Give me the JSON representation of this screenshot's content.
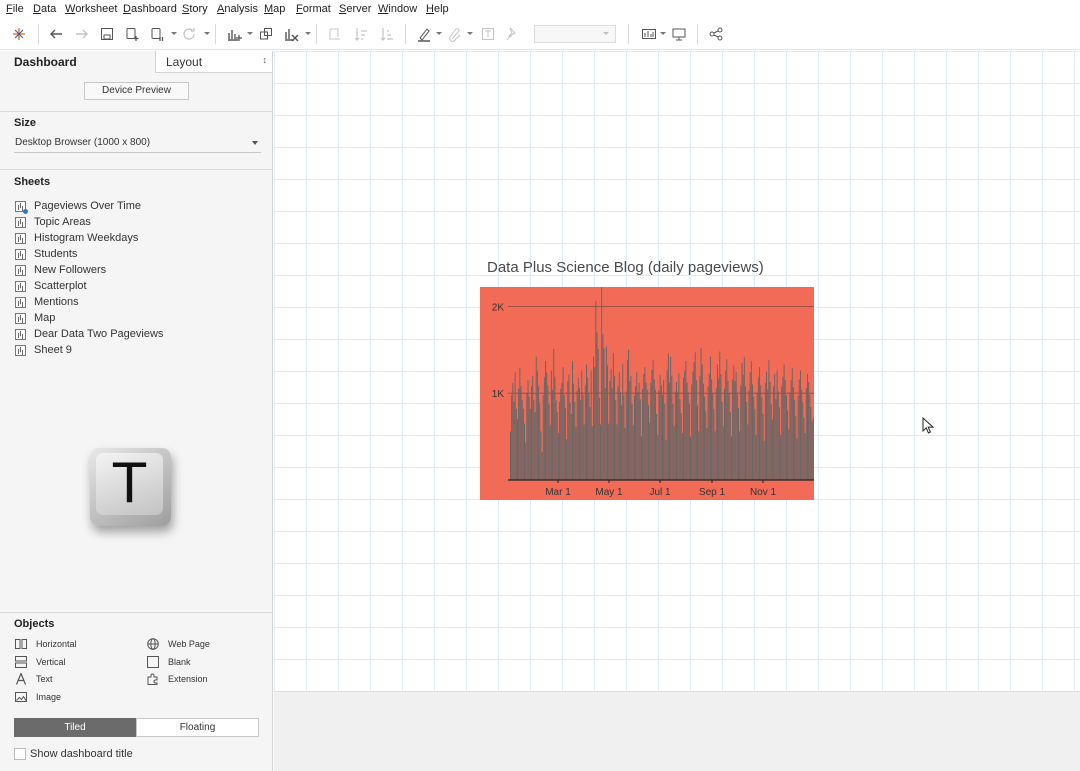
{
  "menu": [
    "File",
    "Data",
    "Worksheet",
    "Dashboard",
    "Story",
    "Analysis",
    "Map",
    "Format",
    "Server",
    "Window",
    "Help"
  ],
  "toolbar": {
    "icons": [
      "tableau-logo-icon",
      "undo-icon",
      "redo-icon",
      "save-icon",
      "new-data-source-icon",
      "pause-updates-icon",
      "refresh-icon",
      "new-worksheet-icon",
      "duplicate-sheet-icon",
      "clear-sheet-icon",
      "swap-icon",
      "sort-ascending-icon",
      "sort-descending-icon",
      "highlight-icon",
      "group-icon",
      "labels-icon",
      "fix-axes-icon",
      "show-me-icon",
      "presentation-icon",
      "share-icon"
    ]
  },
  "left_pane": {
    "tab_dashboard": "Dashboard",
    "tab_layout": "Layout",
    "device_preview": "Device Preview",
    "size_heading": "Size",
    "size_value": "Desktop Browser (1000 x 800)",
    "sheets_heading": "Sheets",
    "sheets": [
      "Pageviews Over Time",
      "Topic Areas",
      "Histogram Weekdays",
      "Students",
      "New Followers",
      "Scatterplot",
      "Mentions",
      "Map",
      "Dear Data Two Pageviews",
      "Sheet 9"
    ],
    "keycap_letter": "T",
    "objects_heading": "Objects",
    "objects": {
      "horizontal": "Horizontal",
      "vertical": "Vertical",
      "text": "Text",
      "image": "Image",
      "web_page": "Web Page",
      "blank": "Blank",
      "extension": "Extension"
    },
    "tiled": "Tiled",
    "floating": "Floating",
    "show_dashboard_title": "Show dashboard title"
  },
  "chart_data": {
    "type": "bar",
    "title": "Data Plus Science Blog (daily pageviews)",
    "background_color": "#f26b57",
    "bar_color": "#666666",
    "xlabel": "",
    "ylabel": "",
    "x_tick_labels": [
      "Mar 1",
      "May 1",
      "Jul 1",
      "Sep 1",
      "Nov 1"
    ],
    "y_tick_labels": [
      "2K",
      "1K"
    ],
    "y_ticks": [
      2000,
      1000
    ],
    "ylim": [
      0,
      2200
    ],
    "series": [
      {
        "values": [
          560,
          980,
          1120,
          900,
          1240,
          820,
          700,
          1050,
          1290,
          1080,
          920,
          820,
          650,
          430,
          1000,
          1150,
          960,
          820,
          1080,
          1200,
          920,
          780,
          1420,
          1260,
          1080,
          890,
          560,
          320,
          980,
          1180,
          1370,
          1240,
          1090,
          880,
          630,
          1260,
          1040,
          1510,
          1190,
          920,
          780,
          540,
          900,
          1050,
          1120,
          1300,
          980,
          830,
          470,
          1140,
          1220,
          890,
          760,
          1370,
          1110,
          900,
          610,
          1030,
          1180,
          1060,
          920,
          1260,
          980,
          640,
          1090,
          1330,
          1180,
          1000,
          840,
          1260,
          620,
          1420,
          1300,
          2060,
          1700,
          1510,
          950,
          640,
          2250,
          1680,
          1520,
          1060,
          1540,
          1320,
          650,
          1140,
          1280,
          1060,
          1460,
          1200,
          920,
          640,
          1080,
          1240,
          1010,
          860,
          1340,
          980,
          600,
          1020,
          1380,
          1500,
          1140,
          1200,
          880,
          630,
          970,
          1080,
          1240,
          1010,
          1120,
          930,
          500,
          1050,
          1220,
          1300,
          1120,
          1040,
          860,
          660,
          1120,
          1270,
          1380,
          1160,
          1040,
          760,
          520,
          1030,
          1210,
          1090,
          980,
          1150,
          880,
          460,
          1270,
          1460,
          1120,
          1420,
          1200,
          880,
          620,
          1020,
          1130,
          1010,
          1230,
          930,
          770,
          540,
          1180,
          1260,
          1370,
          1120,
          1010,
          880,
          500,
          1100,
          1250,
          1360,
          1470,
          1150,
          860,
          560,
          1200,
          1520,
          1330,
          1110,
          960,
          800,
          600,
          1080,
          1220,
          1420,
          1160,
          1000,
          820,
          560,
          1060,
          1330,
          1170,
          1480,
          1220,
          900,
          620,
          1050,
          1260,
          1390,
          1140,
          1000,
          780,
          500,
          1160,
          1320,
          1140,
          1250,
          990,
          830,
          560,
          1090,
          1350,
          1210,
          1410,
          1080,
          900,
          640,
          1030,
          1240,
          1370,
          1100,
          960,
          820,
          520,
          1000,
          1180,
          1300,
          1090,
          950,
          760,
          450,
          1120,
          1250,
          1040,
          1380,
          1130,
          880,
          700,
          1080,
          1220,
          930,
          1260,
          1020,
          840,
          520,
          1080,
          1190,
          1330,
          1150,
          980,
          800,
          580,
          1010,
          1150,
          1290,
          1070,
          920,
          740,
          480,
          970,
          1160,
          1260,
          1040,
          900,
          720,
          540,
          1060,
          1220,
          1130,
          980,
          840,
          680,
          710
        ]
      }
    ]
  }
}
